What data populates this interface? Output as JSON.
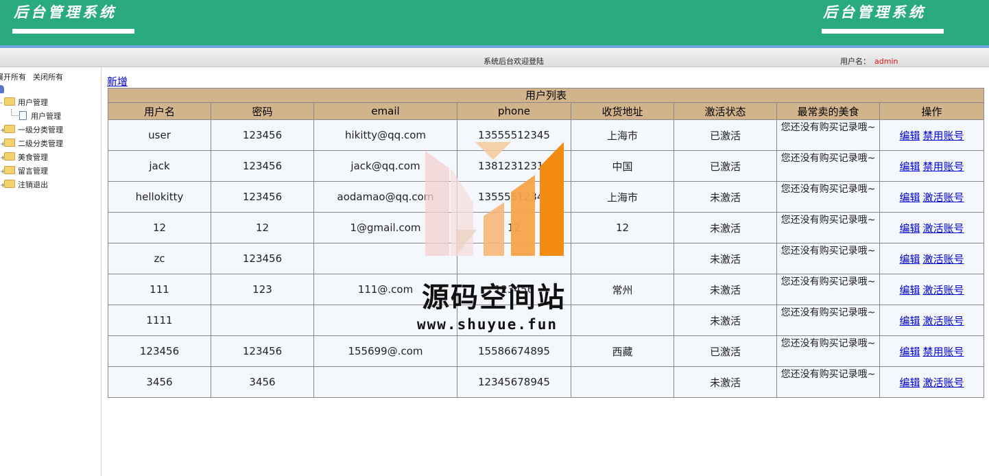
{
  "header": {
    "logo_left": "后台管理系统",
    "logo_right": "后台管理系统",
    "welcome": "系统后台欢迎登陆",
    "user_label": "用户名：",
    "user_name": "admin"
  },
  "sidebar": {
    "expand_all": "展开所有",
    "collapse_all": "关闭所有",
    "nodes": {
      "user_mgmt": "用户管理",
      "user_mgmt_child": "用户管理",
      "cat1": "一级分类管理",
      "cat2": "二级分类管理",
      "food": "美食管理",
      "message": "留言管理",
      "logout": "注销退出"
    }
  },
  "main": {
    "add_label": "新增",
    "table_title": "用户列表",
    "columns": [
      "用户名",
      "密码",
      "email",
      "phone",
      "收货地址",
      "激活状态",
      "最常卖的美食",
      "操作"
    ],
    "edit_label": "编辑",
    "rows": [
      {
        "username": "user",
        "password": "123456",
        "email": "hikitty@qq.com",
        "phone": "13555512345",
        "address": "上海市",
        "status": "已激活",
        "food": "您还没有购买记录哦~",
        "action": "禁用账号"
      },
      {
        "username": "jack",
        "password": "123456",
        "email": "jack@qq.com",
        "phone": "13812312312",
        "address": "中国",
        "status": "已激活",
        "food": "您还没有购买记录哦~",
        "action": "禁用账号"
      },
      {
        "username": "hellokitty",
        "password": "123456",
        "email": "aodamao@qq.com",
        "phone": "13555512345",
        "address": "上海市",
        "status": "未激活",
        "food": "您还没有购买记录哦~",
        "action": "激活账号"
      },
      {
        "username": "12",
        "password": "12",
        "email": "1@gmail.com",
        "phone": "12",
        "address": "12",
        "status": "未激活",
        "food": "您还没有购买记录哦~",
        "action": "激活账号"
      },
      {
        "username": "zc",
        "password": "123456",
        "email": "",
        "phone": "",
        "address": "",
        "status": "未激活",
        "food": "您还没有购买记录哦~",
        "action": "激活账号"
      },
      {
        "username": "111",
        "password": "123",
        "email": "111@.com",
        "phone": "123456",
        "address": "常州",
        "status": "未激活",
        "food": "您还没有购买记录哦~",
        "action": "激活账号"
      },
      {
        "username": "1111",
        "password": "",
        "email": "",
        "phone": "",
        "address": "",
        "status": "未激活",
        "food": "您还没有购买记录哦~",
        "action": "激活账号"
      },
      {
        "username": "123456",
        "password": "123456",
        "email": "155699@.com",
        "phone": "15586674895",
        "address": "西藏",
        "status": "已激活",
        "food": "您还没有购买记录哦~",
        "action": "禁用账号"
      },
      {
        "username": "3456",
        "password": "3456",
        "email": "",
        "phone": "12345678945",
        "address": "",
        "status": "未激活",
        "food": "您还没有购买记录哦~",
        "action": "激活账号"
      }
    ]
  },
  "watermark": {
    "title": "源码空间站",
    "url": "www.shuyue.fun"
  },
  "colors": {
    "header_green": "#2aab7d",
    "table_header": "#d2b48c",
    "link_blue": "#0000cc",
    "admin_red": "#dd1111"
  }
}
